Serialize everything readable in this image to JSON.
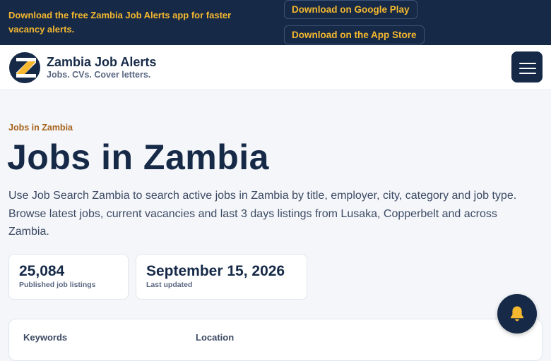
{
  "promo": {
    "text": "Download the free Zambia Job Alerts app for faster vacancy alerts.",
    "google_play": "Download on Google Play",
    "app_store": "Download on the App Store"
  },
  "brand": {
    "name": "Zambia Job Alerts",
    "tagline": "Jobs. CVs. Cover letters."
  },
  "icons": {
    "logo": "zambia-job-alerts-logo",
    "menu": "hamburger-menu-icon",
    "notifications": "bell-icon"
  },
  "breadcrumb": "Jobs in Zambia",
  "page": {
    "title": "Jobs in Zambia",
    "intro": "Use Job Search Zambia to search active jobs in Zambia by title, employer, city, category and job type. Browse latest jobs, current vacancies and last 3 days listings from Lusaka, Copperbelt and across Zambia."
  },
  "stats": [
    {
      "value": "25,084",
      "label": "Published job listings"
    },
    {
      "value": "September 15, 2026",
      "label": "Last updated"
    }
  ],
  "search": {
    "keywords_label": "Keywords",
    "location_label": "Location"
  },
  "colors": {
    "navy": "#162a48",
    "accent": "#f5b82e",
    "breadcrumb": "#a6621a",
    "background": "#f4f6fa"
  }
}
